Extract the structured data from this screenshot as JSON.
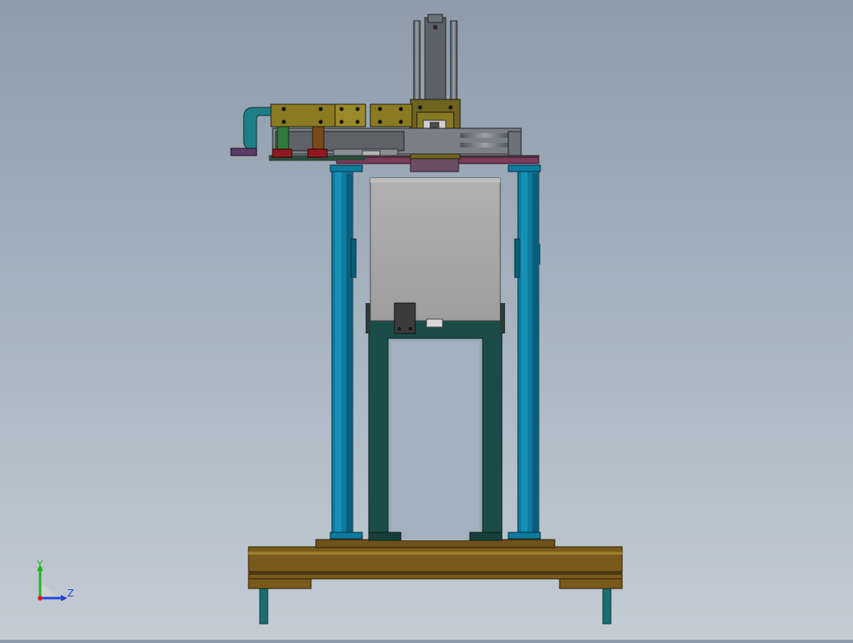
{
  "viewport": {
    "background_top": "#8d9bab",
    "background_bottom": "#c4ccd4",
    "model": "cad-assembly-front-view"
  },
  "triad": {
    "y_label": "Y",
    "z_label": "Z",
    "y_color": "#1fb320",
    "z_color": "#2046d8",
    "x_color": "#d42020"
  },
  "colors": {
    "frame_blue": "#0e7a9e",
    "inner_frame": "#1b4d48",
    "base_wood": "#7a5a1a",
    "housing_gray": "#a8a8a8",
    "olive_block": "#8a7a22",
    "legs_teal": "#1c6d6d"
  }
}
